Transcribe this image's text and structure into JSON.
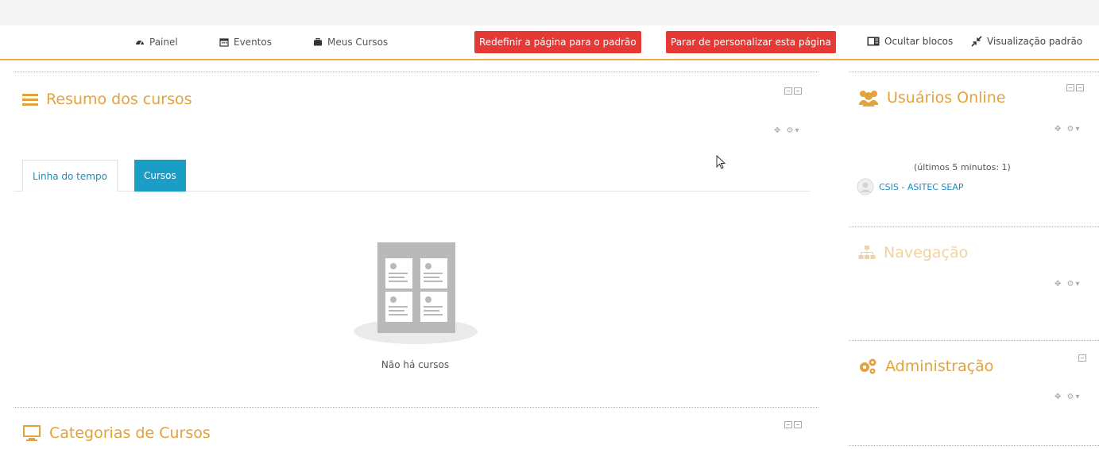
{
  "navbar": {
    "painel": "Painel",
    "eventos": "Eventos",
    "meus_cursos": "Meus Cursos",
    "reset_button": "Redefinir a página para o padrão",
    "stop_button": "Parar de personalizar esta página",
    "hide_blocks": "Ocultar blocos",
    "default_view": "Visualização padrão"
  },
  "course_overview": {
    "title": "Resumo dos cursos",
    "tabs": [
      "Linha do tempo",
      "Cursos"
    ],
    "active_tab": "Cursos",
    "empty_message": "Não há cursos"
  },
  "course_categories": {
    "title": "Categorias de Cursos"
  },
  "online_users": {
    "title": "Usuários Online",
    "subtitle": "(últimos 5 minutos: 1)",
    "users": [
      "CSIS - ASITEC SEAP"
    ]
  },
  "navigation": {
    "title": "Navegação"
  },
  "administration": {
    "title": "Administração"
  },
  "colors": {
    "accent_orange": "#e3a23c",
    "danger_red": "#e53935",
    "tab_active_blue": "#1a9ec8",
    "link_blue": "#1c8cc1"
  }
}
